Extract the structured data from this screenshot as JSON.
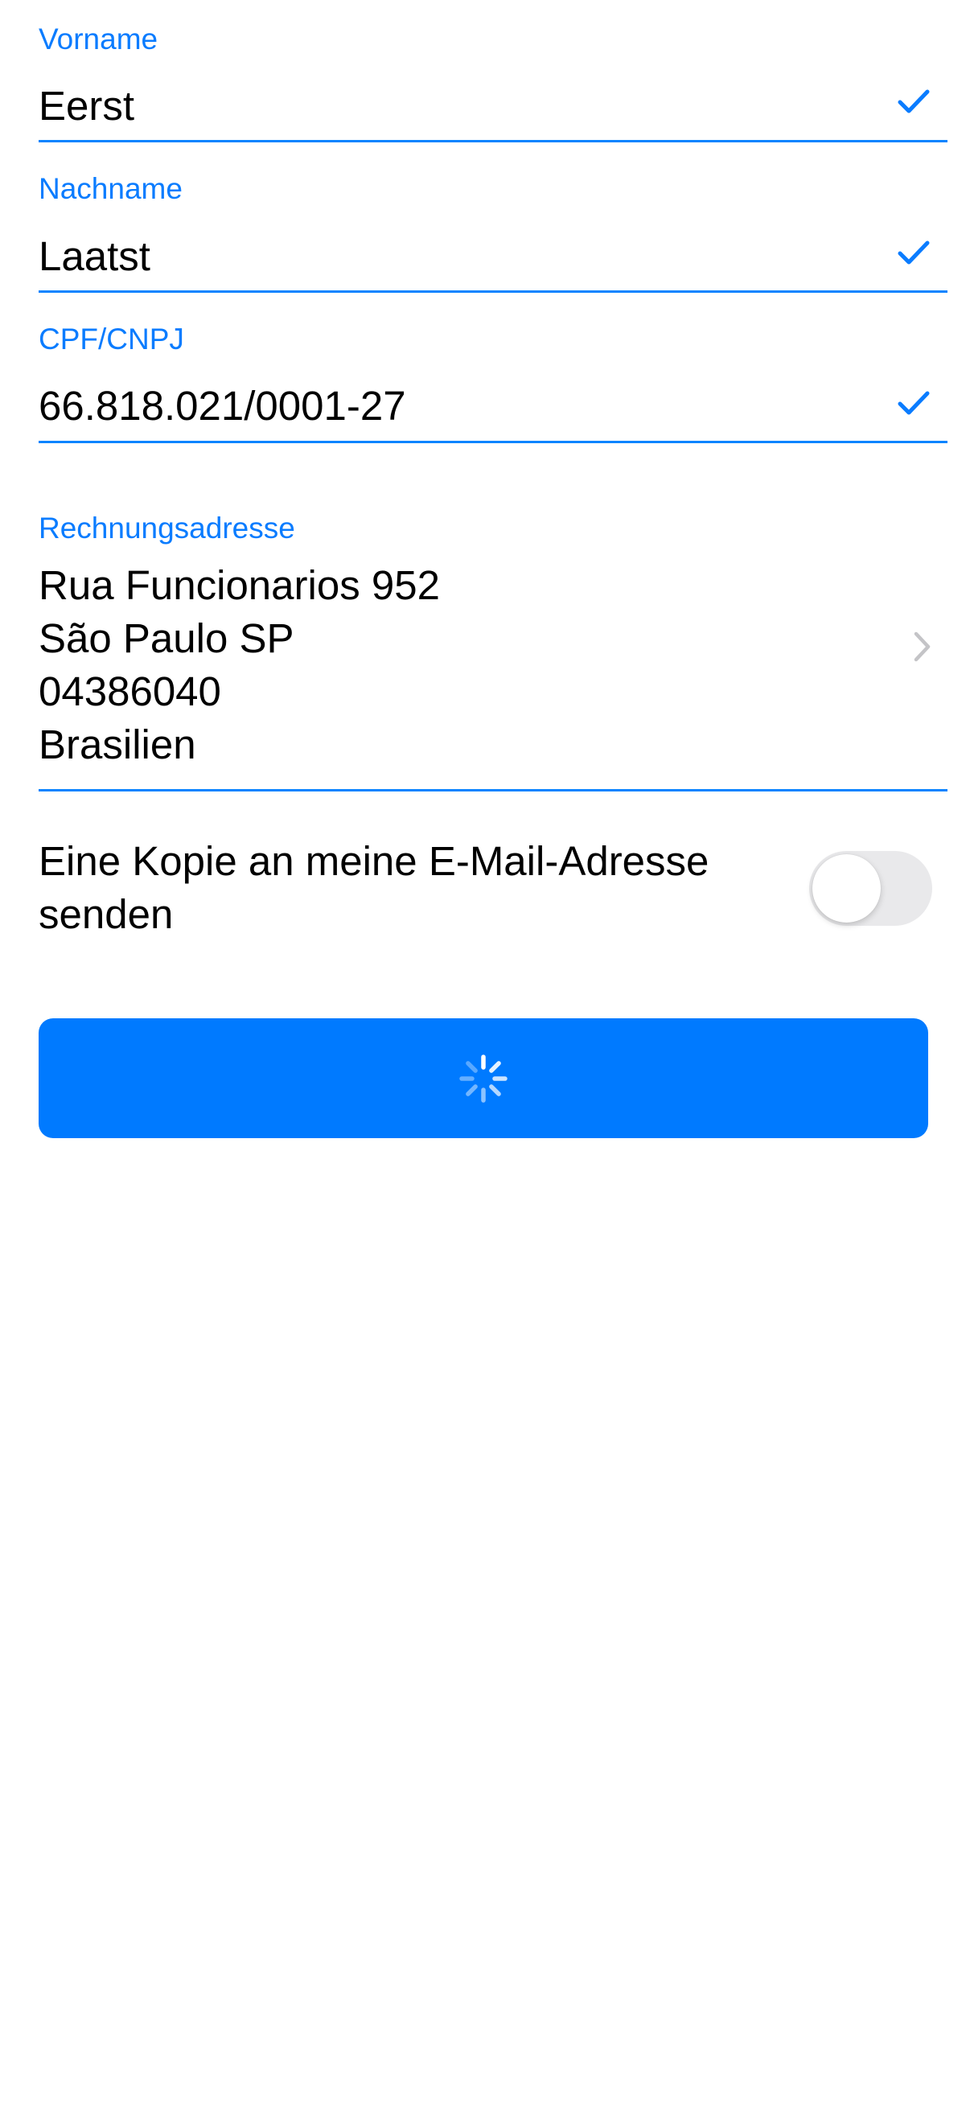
{
  "form": {
    "first_name": {
      "label": "Vorname",
      "value": "Eerst"
    },
    "last_name": {
      "label": "Nachname",
      "value": "Laatst"
    },
    "tax_id": {
      "label": "CPF/CNPJ",
      "value": "66.818.021/0001-27"
    },
    "billing_address": {
      "label": "Rechnungsadresse",
      "lines": [
        "Rua Funcionarios 952",
        "São Paulo SP",
        "04386040",
        "Brasilien"
      ]
    },
    "email_copy": {
      "label": "Eine Kopie an meine E-Mail-Adresse senden",
      "enabled": false
    },
    "submit": {
      "state": "loading",
      "icon": "spinner-icon"
    }
  },
  "icons": {
    "valid": "checkmark-icon",
    "navigate": "chevron-right-icon"
  },
  "colors": {
    "accent": "#007aff",
    "label": "#0a7cff",
    "toggle_off": "#e9e9eb",
    "chevron": "#c4c4c7"
  }
}
